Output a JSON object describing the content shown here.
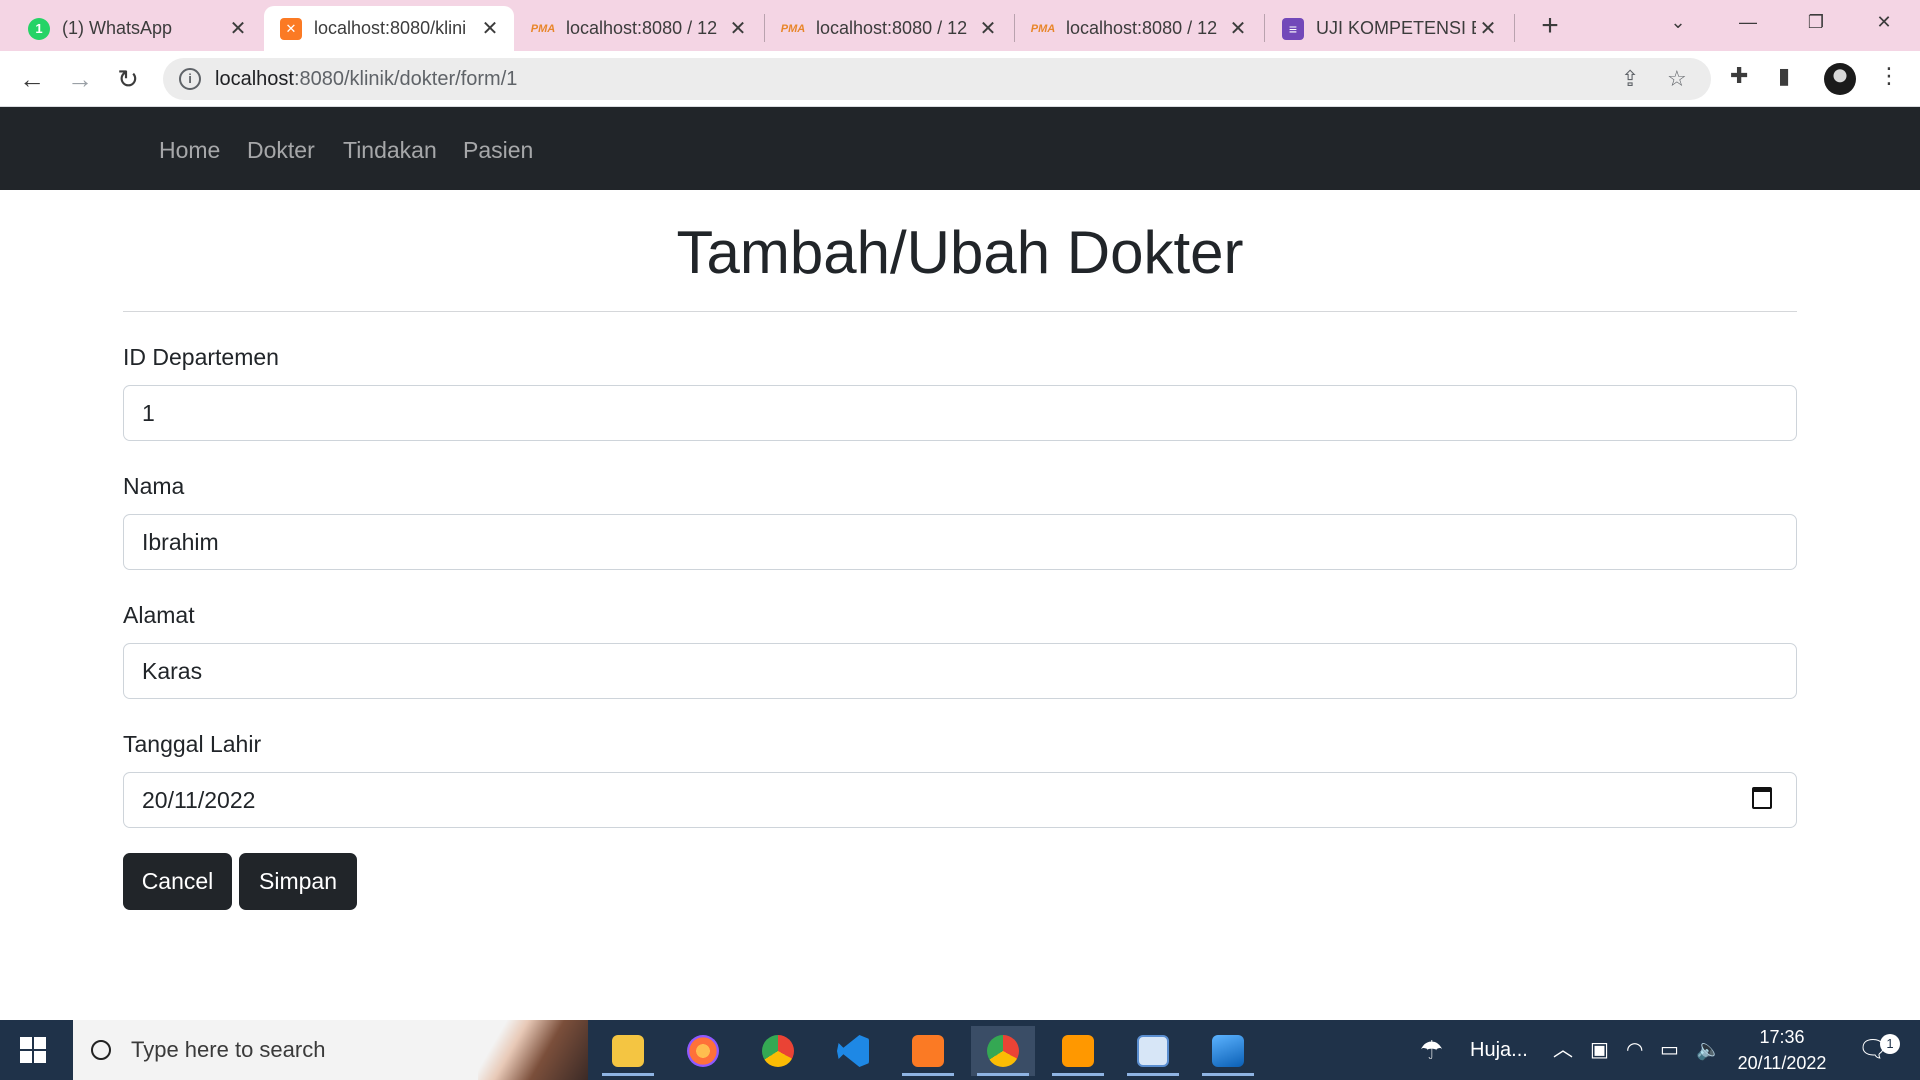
{
  "browser": {
    "tabs": [
      {
        "title": "(1) WhatsApp",
        "favicon": "whatsapp-icon",
        "badge": "1"
      },
      {
        "title": "localhost:8080/klini",
        "favicon": "xampp-icon",
        "active": true
      },
      {
        "title": "localhost:8080 / 12",
        "favicon": "phpmyadmin-icon"
      },
      {
        "title": "localhost:8080 / 12",
        "favicon": "phpmyadmin-icon"
      },
      {
        "title": "localhost:8080 / 12",
        "favicon": "phpmyadmin-icon"
      },
      {
        "title": "UJI KOMPETENSI BI",
        "favicon": "google-forms-icon"
      }
    ],
    "address": {
      "host": "localhost",
      "path": ":8080/klinik/dokter/form/1"
    }
  },
  "navbar": {
    "links": [
      "Home",
      "Dokter",
      "Tindakan",
      "Pasien"
    ]
  },
  "form": {
    "title": "Tambah/Ubah Dokter",
    "fields": [
      {
        "label": "ID Departemen",
        "value": "1"
      },
      {
        "label": "Nama",
        "value": "Ibrahim"
      },
      {
        "label": "Alamat",
        "value": "Karas"
      },
      {
        "label": "Tanggal Lahir",
        "value": "20/11/2022"
      }
    ],
    "cancel_label": "Cancel",
    "submit_label": "Simpan"
  },
  "taskbar": {
    "search_placeholder": "Type here to search",
    "weather": "Huja...",
    "time": "17:36",
    "date": "20/11/2022",
    "notification_count": "1"
  },
  "colors": {
    "tabstrip": "#f4d5e4",
    "navbar": "#212529",
    "button": "#212529",
    "taskbar": "#1f3249"
  }
}
